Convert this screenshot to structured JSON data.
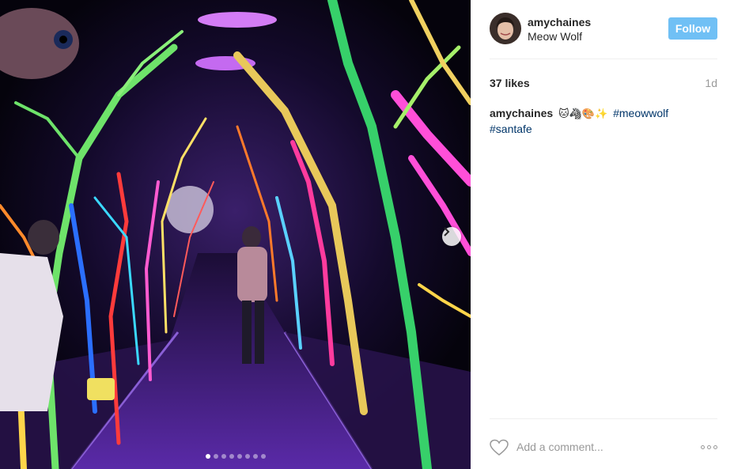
{
  "post": {
    "username": "amychaines",
    "location": "Meow Wolf",
    "follow_label": "Follow",
    "likes": "37 likes",
    "time_ago": "1d",
    "caption": {
      "username": "amychaines",
      "emojis": "🐱🦓🎨✨",
      "hashtags": [
        "#meowwolf",
        "#santafe"
      ]
    },
    "comment_placeholder": "Add a comment...",
    "carousel": {
      "total": 8,
      "current": 1
    }
  },
  "icons": {
    "next": "chevron-right-icon",
    "like": "heart-outline-icon",
    "options": "more-options-icon"
  },
  "colors": {
    "follow_button": "#70c0f5",
    "hashtag": "#003569",
    "muted": "#999999"
  }
}
